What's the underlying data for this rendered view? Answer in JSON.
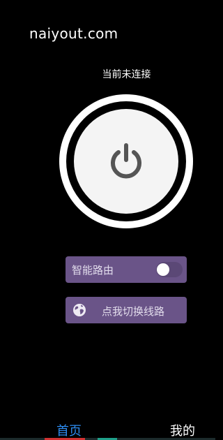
{
  "watermark": "naiyout.com",
  "status": "当前未连接",
  "power_button": {
    "icon": "power-icon"
  },
  "smart_route": {
    "label": "智能路由",
    "enabled": false
  },
  "switch_line": {
    "icon": "globe-icon",
    "label": "点我切换线路"
  },
  "tabs": [
    {
      "label": "首页",
      "active": true
    },
    {
      "label": "我的",
      "active": false
    }
  ],
  "colors": {
    "background": "#000000",
    "row_background": "#6a5488",
    "active_tab": "#2d8cf0",
    "power_face": "#f4f4f4",
    "power_icon": "#555555"
  }
}
